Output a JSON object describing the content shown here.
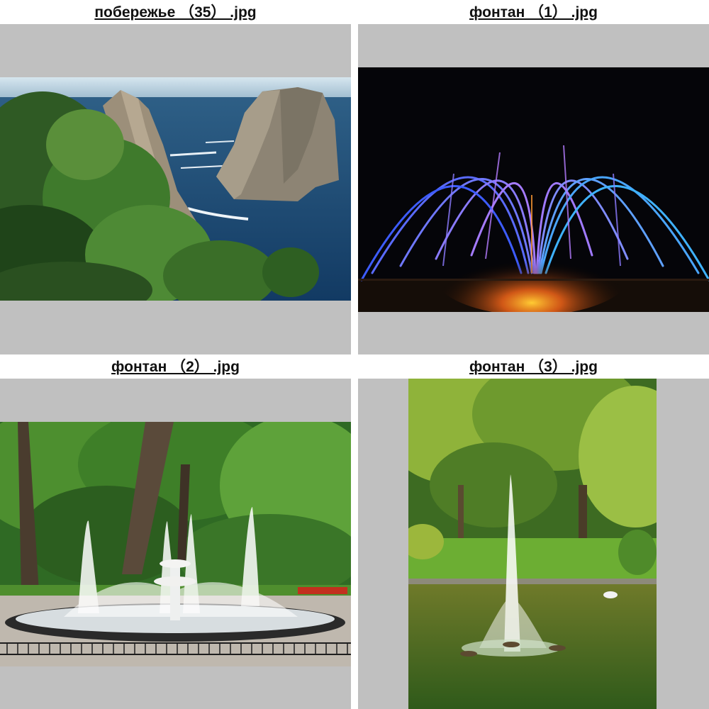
{
  "gallery": {
    "items": [
      {
        "filename": "побережье （35） .jpg",
        "subject": "coastline"
      },
      {
        "filename": "фонтан （1） .jpg",
        "subject": "night-fountain"
      },
      {
        "filename": "фонтан （2） .jpg",
        "subject": "park-fountain"
      },
      {
        "filename": "фонтан （3） .jpg",
        "subject": "pond-fountain"
      }
    ]
  },
  "colors": {
    "thumb_background": "#c0c0c0",
    "caption_text": "#111111",
    "page_background": "#ffffff"
  }
}
